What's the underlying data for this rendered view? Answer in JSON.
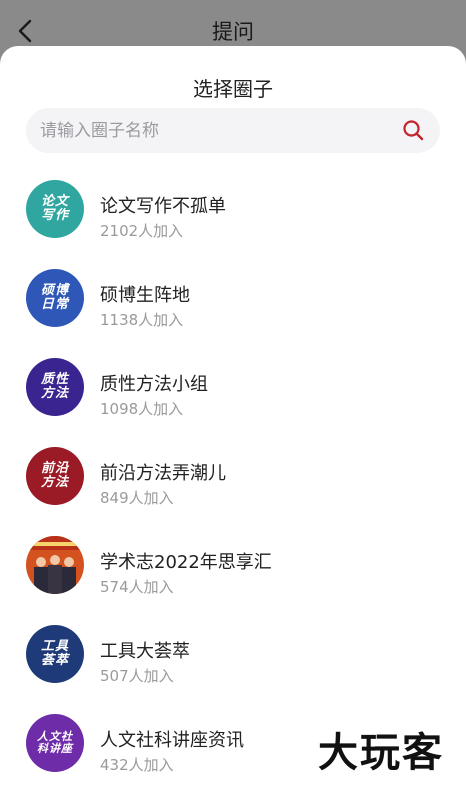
{
  "header": {
    "title": "提问",
    "back_icon": "chevron-left-icon"
  },
  "sheet": {
    "title": "选择圈子"
  },
  "search": {
    "placeholder": "请输入圈子名称",
    "icon": "search-icon",
    "icon_color": "#c2252d"
  },
  "circles": [
    {
      "name": "论文写作不孤单",
      "members": "2102人加入",
      "avatar_text": "论文写作",
      "avatar_color": "#2fa7a0"
    },
    {
      "name": "硕博生阵地",
      "members": "1138人加入",
      "avatar_text": "硕博日常",
      "avatar_color": "#2f57b8"
    },
    {
      "name": "质性方法小组",
      "members": "1098人加入",
      "avatar_text": "质性方法",
      "avatar_color": "#3a2590"
    },
    {
      "name": "前沿方法弄潮儿",
      "members": "849人加入",
      "avatar_text": "前沿方法",
      "avatar_color": "#9a1a26"
    },
    {
      "name": "学术志2022年思享汇",
      "members": "574人加入",
      "avatar_text": "",
      "avatar_color": "#d4521f"
    },
    {
      "name": "工具大荟萃",
      "members": "507人加入",
      "avatar_text": "工具荟萃",
      "avatar_color": "#1f3a78"
    },
    {
      "name": "人文社科讲座资讯",
      "members": "432人加入",
      "avatar_text": "人文社科讲座",
      "avatar_color": "#6e2ca8"
    }
  ],
  "watermark": "大玩客"
}
